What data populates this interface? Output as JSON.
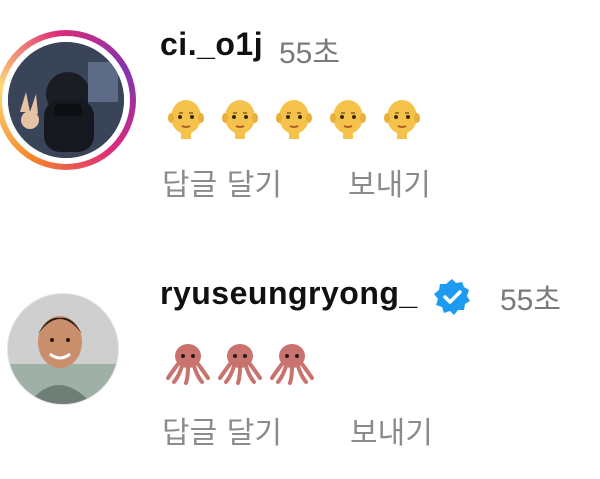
{
  "comments": [
    {
      "username": "ci._o1j",
      "time": "55초",
      "verified": false,
      "has_story_ring": true,
      "emoji": {
        "glyph": "👨‍🦲",
        "count": 5,
        "icon_name": "bald-man-icon"
      },
      "actions": {
        "reply": "답글 달기",
        "send": "보내기"
      }
    },
    {
      "username": "ryuseungryong_",
      "time": "55초",
      "verified": true,
      "has_story_ring": false,
      "emoji": {
        "glyph": "🐙",
        "count": 3,
        "icon_name": "octopus-icon"
      },
      "actions": {
        "reply": "답글 달기",
        "send": "보내기"
      }
    }
  ],
  "colors": {
    "text_primary": "#111111",
    "text_secondary": "#8b8b8b",
    "verified_blue": "#1d9bf0",
    "story_ring": [
      "#f58529",
      "#feda77",
      "#dd2a7b",
      "#8134af"
    ]
  }
}
